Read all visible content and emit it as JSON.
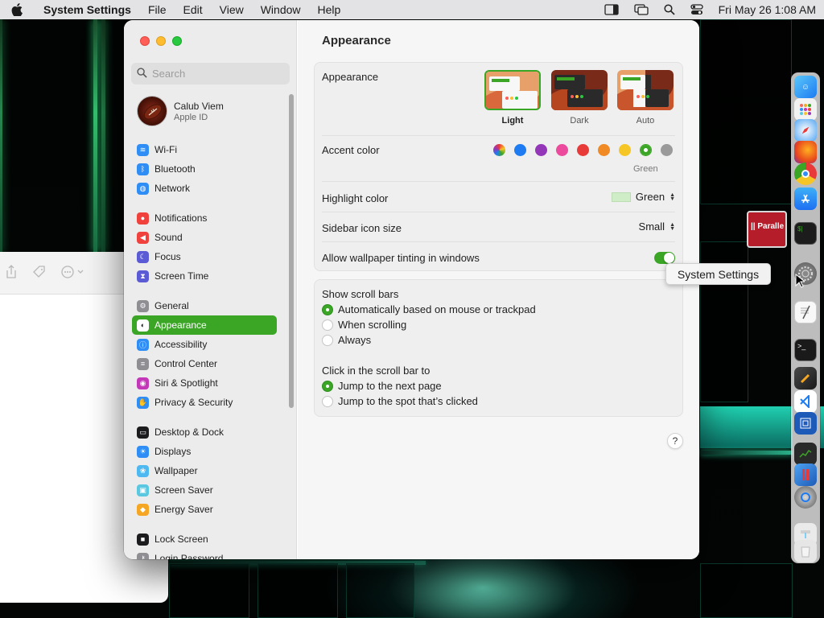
{
  "menubar": {
    "app_name": "System Settings",
    "items": [
      "File",
      "Edit",
      "View",
      "Window",
      "Help"
    ],
    "clock": "Fri May 26  1:08 AM"
  },
  "sidebar": {
    "search_placeholder": "Search",
    "account": {
      "name": "Calub Viem",
      "subtitle": "Apple ID"
    },
    "groups": [
      [
        {
          "label": "Wi-Fi",
          "icon": "wifi-icon",
          "color": "#2f8ef6"
        },
        {
          "label": "Bluetooth",
          "icon": "bluetooth-icon",
          "color": "#2f8ef6"
        },
        {
          "label": "Network",
          "icon": "globe-icon",
          "color": "#2f8ef6"
        }
      ],
      [
        {
          "label": "Notifications",
          "icon": "bell-icon",
          "color": "#f0413d"
        },
        {
          "label": "Sound",
          "icon": "speaker-icon",
          "color": "#f0413d"
        },
        {
          "label": "Focus",
          "icon": "moon-icon",
          "color": "#5b5bd6"
        },
        {
          "label": "Screen Time",
          "icon": "hourglass-icon",
          "color": "#5b5bd6"
        }
      ],
      [
        {
          "label": "General",
          "icon": "gear-icon",
          "color": "#8e8e93"
        },
        {
          "label": "Appearance",
          "icon": "appearance-icon",
          "color": "#1c1c1e",
          "active": true
        },
        {
          "label": "Accessibility",
          "icon": "accessibility-icon",
          "color": "#2f8ef6"
        },
        {
          "label": "Control Center",
          "icon": "control-center-icon",
          "color": "#8e8e93"
        },
        {
          "label": "Siri & Spotlight",
          "icon": "siri-icon",
          "color": "#c437b8"
        },
        {
          "label": "Privacy & Security",
          "icon": "hand-icon",
          "color": "#2f8ef6"
        }
      ],
      [
        {
          "label": "Desktop & Dock",
          "icon": "dock-icon",
          "color": "#1c1c1e"
        },
        {
          "label": "Displays",
          "icon": "sun-icon",
          "color": "#2f8ef6"
        },
        {
          "label": "Wallpaper",
          "icon": "flower-icon",
          "color": "#4eb8f0"
        },
        {
          "label": "Screen Saver",
          "icon": "screen-saver-icon",
          "color": "#5ac8e0"
        },
        {
          "label": "Energy Saver",
          "icon": "bulb-icon",
          "color": "#f5a623"
        }
      ],
      [
        {
          "label": "Lock Screen",
          "icon": "lock-icon",
          "color": "#1c1c1e"
        },
        {
          "label": "Login Password",
          "icon": "key-icon",
          "color": "#8e8e93"
        }
      ]
    ]
  },
  "main": {
    "title": "Appearance",
    "appearance_label": "Appearance",
    "modes": [
      {
        "label": "Light",
        "selected": true
      },
      {
        "label": "Dark",
        "selected": false
      },
      {
        "label": "Auto",
        "selected": false
      }
    ],
    "accent_label": "Accent color",
    "accent_colors": [
      "multicolor",
      "#1e7bf2",
      "#9436b8",
      "#ec4a9c",
      "#e93a3a",
      "#f08a24",
      "#f6c626",
      "#3ba526",
      "#9a9a9a"
    ],
    "accent_selected_name": "Green",
    "highlight_label": "Highlight color",
    "highlight_value": "Green",
    "highlight_swatch": "#cfedc6",
    "sidebar_icon_label": "Sidebar icon size",
    "sidebar_icon_value": "Small",
    "wallpaper_tint_label": "Allow wallpaper tinting in windows",
    "wallpaper_tint_on": true,
    "scroll_bars_label": "Show scroll bars",
    "scroll_options": [
      {
        "label": "Automatically based on mouse or trackpad",
        "selected": true
      },
      {
        "label": "When scrolling",
        "selected": false
      },
      {
        "label": "Always",
        "selected": false
      }
    ],
    "click_label": "Click in the scroll bar to",
    "click_options": [
      {
        "label": "Jump to the next page",
        "selected": true
      },
      {
        "label": "Jump to the spot that’s clicked",
        "selected": false
      }
    ],
    "help_label": "?"
  },
  "dock": {
    "tooltip": "System Settings",
    "parallels_label": "|| Paralle"
  },
  "accent": "#3ba526"
}
